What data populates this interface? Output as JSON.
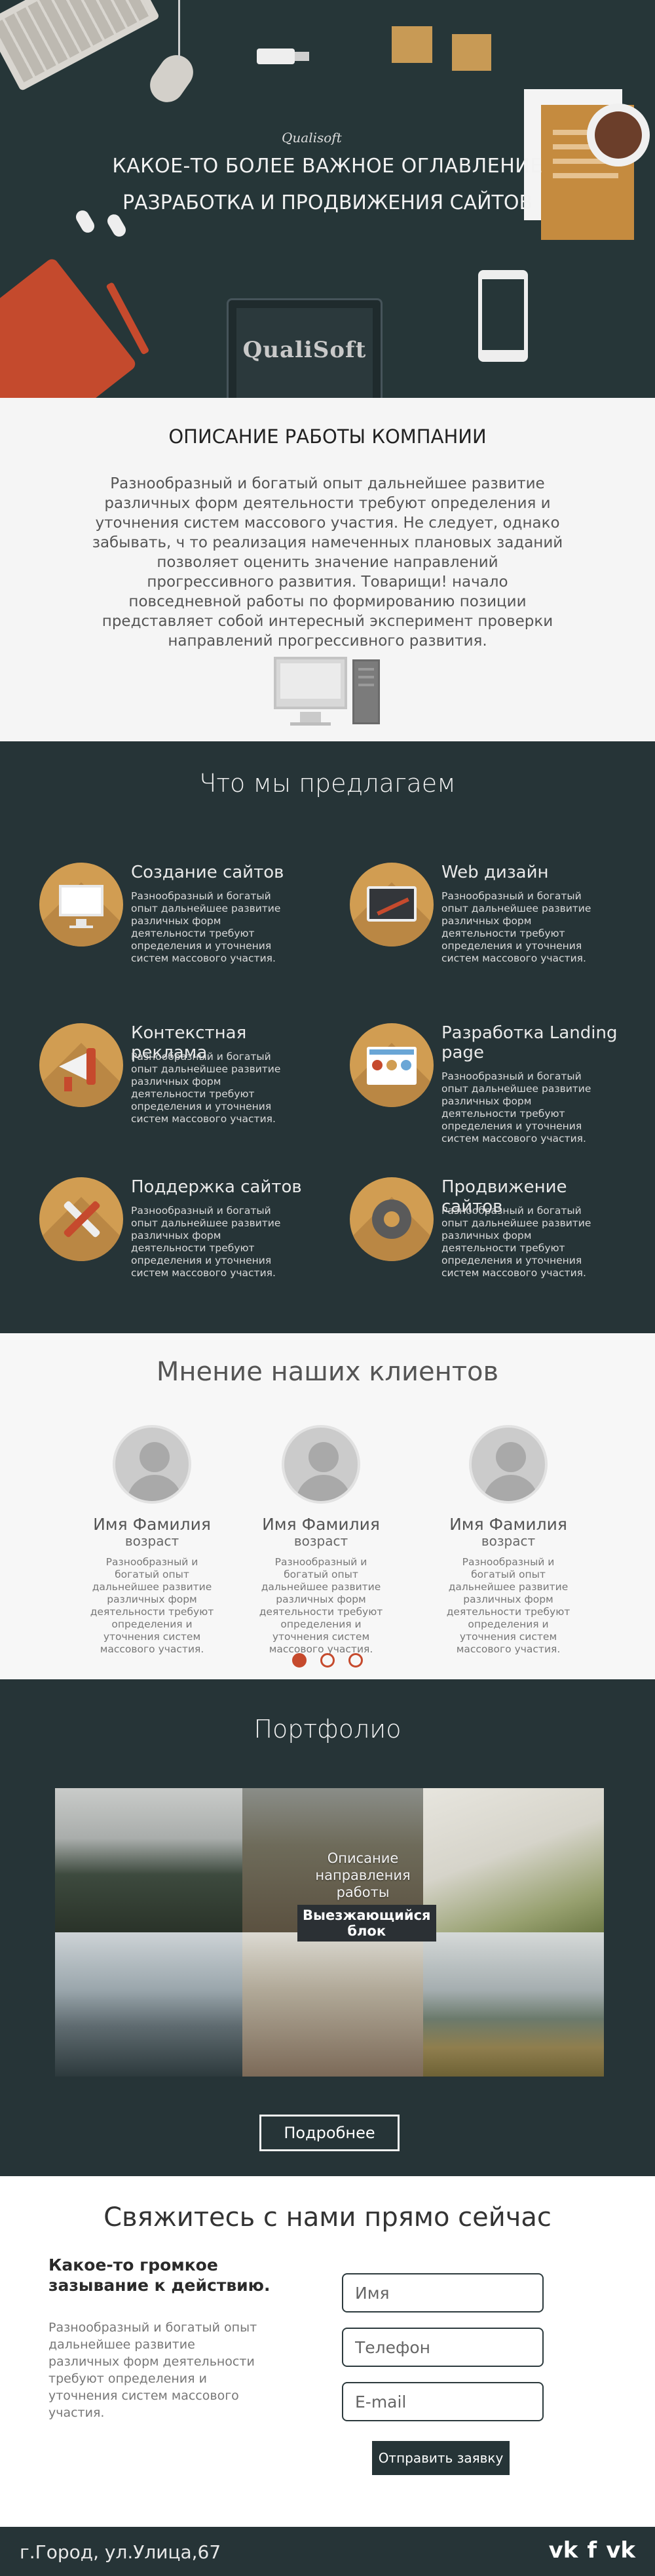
{
  "hero": {
    "small_logo": "Qualisoft",
    "title": "КАКОЕ-ТО БОЛЕЕ ВАЖНОЕ ОГЛАВЛЕНИЕ",
    "subtitle": "РАЗРАБОТКА И ПРОДВИЖЕНИЯ САЙТОВ",
    "laptop_logo": "QualiSoft"
  },
  "about": {
    "title": "ОПИСАНИЕ РАБОТЫ КОМПАНИИ",
    "text": "Разнообразный и богатый опыт дальнейшее развитие различных форм деятельности требуют определения и уточнения систем массового участия. Не следует, однако забывать, ч то реализация намеченных плановых заданий позволяет оценить значение направлений прогрессивного развития. Товарищи! начало повседневной работы по формированию позиции представляет собой интересный эксперимент проверки направлений прогрессивного развития."
  },
  "services": {
    "title": "Что мы предлагаем",
    "items": [
      {
        "title": "Создание сайтов",
        "icon": "monitor-icon",
        "desc": "Разнообразный и богатый опыт дальнейшее развитие различных форм деятельности требуют определения и уточнения систем массового участия."
      },
      {
        "title": "Web дизайн",
        "icon": "design-tablet-icon",
        "desc": "Разнообразный и богатый опыт дальнейшее развитие различных форм деятельности требуют определения и уточнения систем массового участия."
      },
      {
        "title": "Контекстная реклама",
        "icon": "megaphone-icon",
        "desc": "Разнообразный и богатый опыт дальнейшее развитие различных форм деятельности требуют определения и уточнения систем массового участия."
      },
      {
        "title": "Разработка Landing page",
        "icon": "landing-page-icon",
        "desc": "Разнообразный и богатый опыт дальнейшее развитие различных форм деятельности требуют определения и уточнения систем массового участия."
      },
      {
        "title": "Поддержка сайтов",
        "icon": "tools-icon",
        "desc": "Разнообразный и богатый опыт дальнейшее развитие различных форм деятельности требуют определения и уточнения систем массового участия."
      },
      {
        "title": "Продвижение сайтов",
        "icon": "gear-icon",
        "desc": "Разнообразный и богатый опыт дальнейшее развитие различных форм деятельности требуют определения и уточнения систем массового участия."
      }
    ]
  },
  "reviews": {
    "title": "Мнение наших клиентов",
    "items": [
      {
        "name": "Имя Фамилия",
        "age": "возраст",
        "text": "Разнообразный и богатый опыт дальнейшее развитие различных форм деятельности требуют определения и уточнения систем массового участия."
      },
      {
        "name": "Имя Фамилия",
        "age": "возраст",
        "text": "Разнообразный и богатый опыт дальнейшее развитие различных форм деятельности требуют определения и уточнения систем массового участия."
      },
      {
        "name": "Имя Фамилия",
        "age": "возраст",
        "text": "Разнообразный и богатый опыт дальнейшее развитие различных форм деятельности требуют определения и уточнения систем массового участия."
      }
    ],
    "active_slide": 1
  },
  "portfolio": {
    "title": "Портфолио",
    "overlay_desc": "Описание направления работы",
    "overlay_label": "Выезжающийся блок",
    "more_button": "Подробнее"
  },
  "contact": {
    "title": "Свяжитесь с нами прямо сейчас",
    "cta": "Какое-то громкое зазывание к действию.",
    "text": "Разнообразный и богатый опыт дальнейшее развитие различных форм деятельности требуют определения и уточнения систем массового участия.",
    "name_placeholder": "Имя",
    "phone_placeholder": "Телефон",
    "email_placeholder": "E-mail",
    "submit": "Отправить заявку"
  },
  "footer": {
    "address": "г.Город, ул.Улица,67",
    "social": [
      "vk-icon",
      "facebook-icon",
      "vk-icon"
    ],
    "social_glyphs": [
      "vk",
      "f",
      "vk"
    ]
  },
  "colors": {
    "dark": "#263437",
    "accent": "#d19d52",
    "red": "#c64a2d"
  }
}
